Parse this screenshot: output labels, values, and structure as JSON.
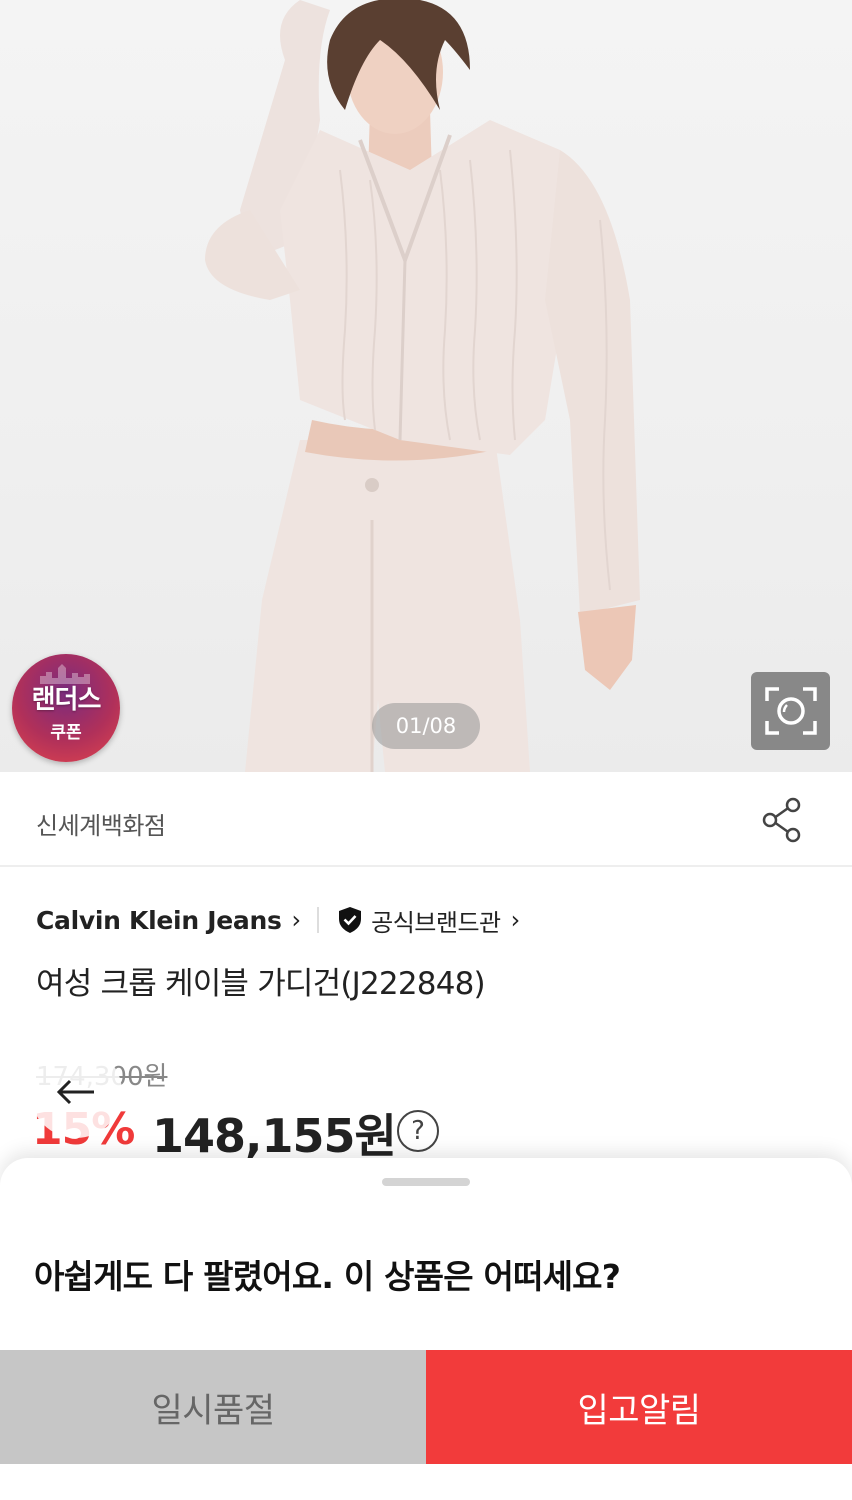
{
  "gallery": {
    "coupon_badge": {
      "line1": "랜더스",
      "line2": "쿠폰"
    },
    "page_indicator": "01/08"
  },
  "store": {
    "name": "신세계백화점"
  },
  "product": {
    "brand": "Calvin Klein Jeans",
    "official_label": "공식브랜드관",
    "title": "여성 크롭 케이블 가디건(J222848)",
    "original_price": "174,300",
    "currency": "원",
    "discount": "15%",
    "sale_price": "148,155원",
    "help_symbol": "?"
  },
  "sheet": {
    "message": "아쉽게도 다 팔렸어요. 이 상품은 어떠세요?",
    "soldout_label": "일시품절",
    "notify_label": "입고알림"
  },
  "colors": {
    "accent_red": "#f23b3b",
    "soldout_gray": "#c6c6c6",
    "image_bg": "#efefef",
    "garment": "#efe3df"
  },
  "icons": [
    "camera-lens-icon",
    "share-icon",
    "chevron-right-icon",
    "shield-check-icon",
    "question-icon",
    "back-arrow-icon"
  ]
}
